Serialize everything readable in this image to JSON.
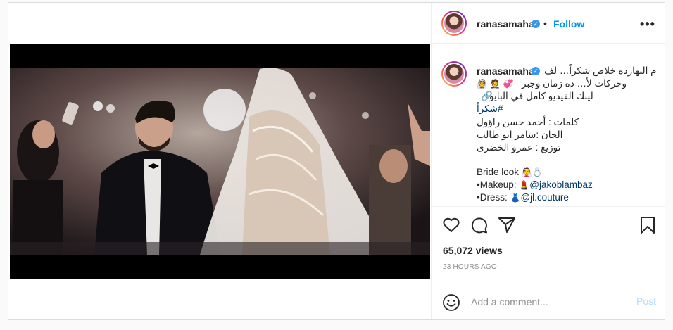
{
  "post": {
    "author": {
      "username": "ranasamaha",
      "verified": true,
      "follow_label": "Follow",
      "separator": "•"
    },
    "more_icon": "more-dots-icon",
    "caption": {
      "line1": "م النهارده خلاص شكراً… لف",
      "line2": "وحركات لأ… ده زمان وجبر",
      "line3": "لينك الفيديو كامل في البايو",
      "hashtag": "#شكراً",
      "line5": "كلمات : أحمد حسن راؤول",
      "line6": "الحان :سامر ابو طالب",
      "line7": "توزيع : عمرو الخضرى",
      "line8": "Bride look",
      "makeup_label": "•Makeup:",
      "makeup_handle": "@jakoblambaz",
      "dress_label": "•Dress:",
      "dress_handle": "@jl.couture"
    },
    "views": "65,072 views",
    "time": "23 HOURS AGO",
    "comment": {
      "placeholder": "Add a comment...",
      "post_label": "Post"
    },
    "colors": {
      "accent": "#0095f6",
      "link": "#00376b",
      "post_disabled": "#b3dbff",
      "verified": "#3897f0"
    }
  }
}
